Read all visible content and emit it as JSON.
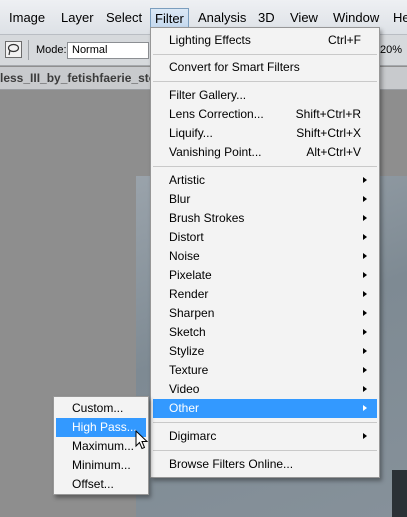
{
  "menubar": {
    "items": [
      "Image",
      "Layer",
      "Select",
      "Filter",
      "Analysis",
      "3D",
      "View",
      "Window",
      "He"
    ],
    "active": "Filter"
  },
  "options": {
    "tool_icon": "lasso-tool-icon",
    "mode_label": "Mode:",
    "mode_value": "Normal",
    "right_value": "20%"
  },
  "document": {
    "tab_title": "less_III_by_fetishfaerie_stock"
  },
  "filter_menu": {
    "top": [
      {
        "label": "Lighting Effects",
        "shortcut": "Ctrl+F"
      }
    ],
    "convert": {
      "label": "Convert for Smart Filters"
    },
    "gallery": [
      {
        "label": "Filter Gallery...",
        "shortcut": ""
      },
      {
        "label": "Lens Correction...",
        "shortcut": "Shift+Ctrl+R"
      },
      {
        "label": "Liquify...",
        "shortcut": "Shift+Ctrl+X"
      },
      {
        "label": "Vanishing Point...",
        "shortcut": "Alt+Ctrl+V"
      }
    ],
    "submenus": [
      "Artistic",
      "Blur",
      "Brush Strokes",
      "Distort",
      "Noise",
      "Pixelate",
      "Render",
      "Sharpen",
      "Sketch",
      "Stylize",
      "Texture",
      "Video",
      "Other"
    ],
    "highlighted": "Other",
    "digimarc": "Digimarc",
    "browse": "Browse Filters Online..."
  },
  "other_submenu": {
    "items": [
      "Custom...",
      "High Pass...",
      "Maximum...",
      "Minimum...",
      "Offset..."
    ],
    "highlighted": "High Pass..."
  },
  "colors": {
    "highlight": "#3399ff",
    "menu_bg": "#f3f3f3",
    "menubar_bg": "#e6e9ed"
  }
}
